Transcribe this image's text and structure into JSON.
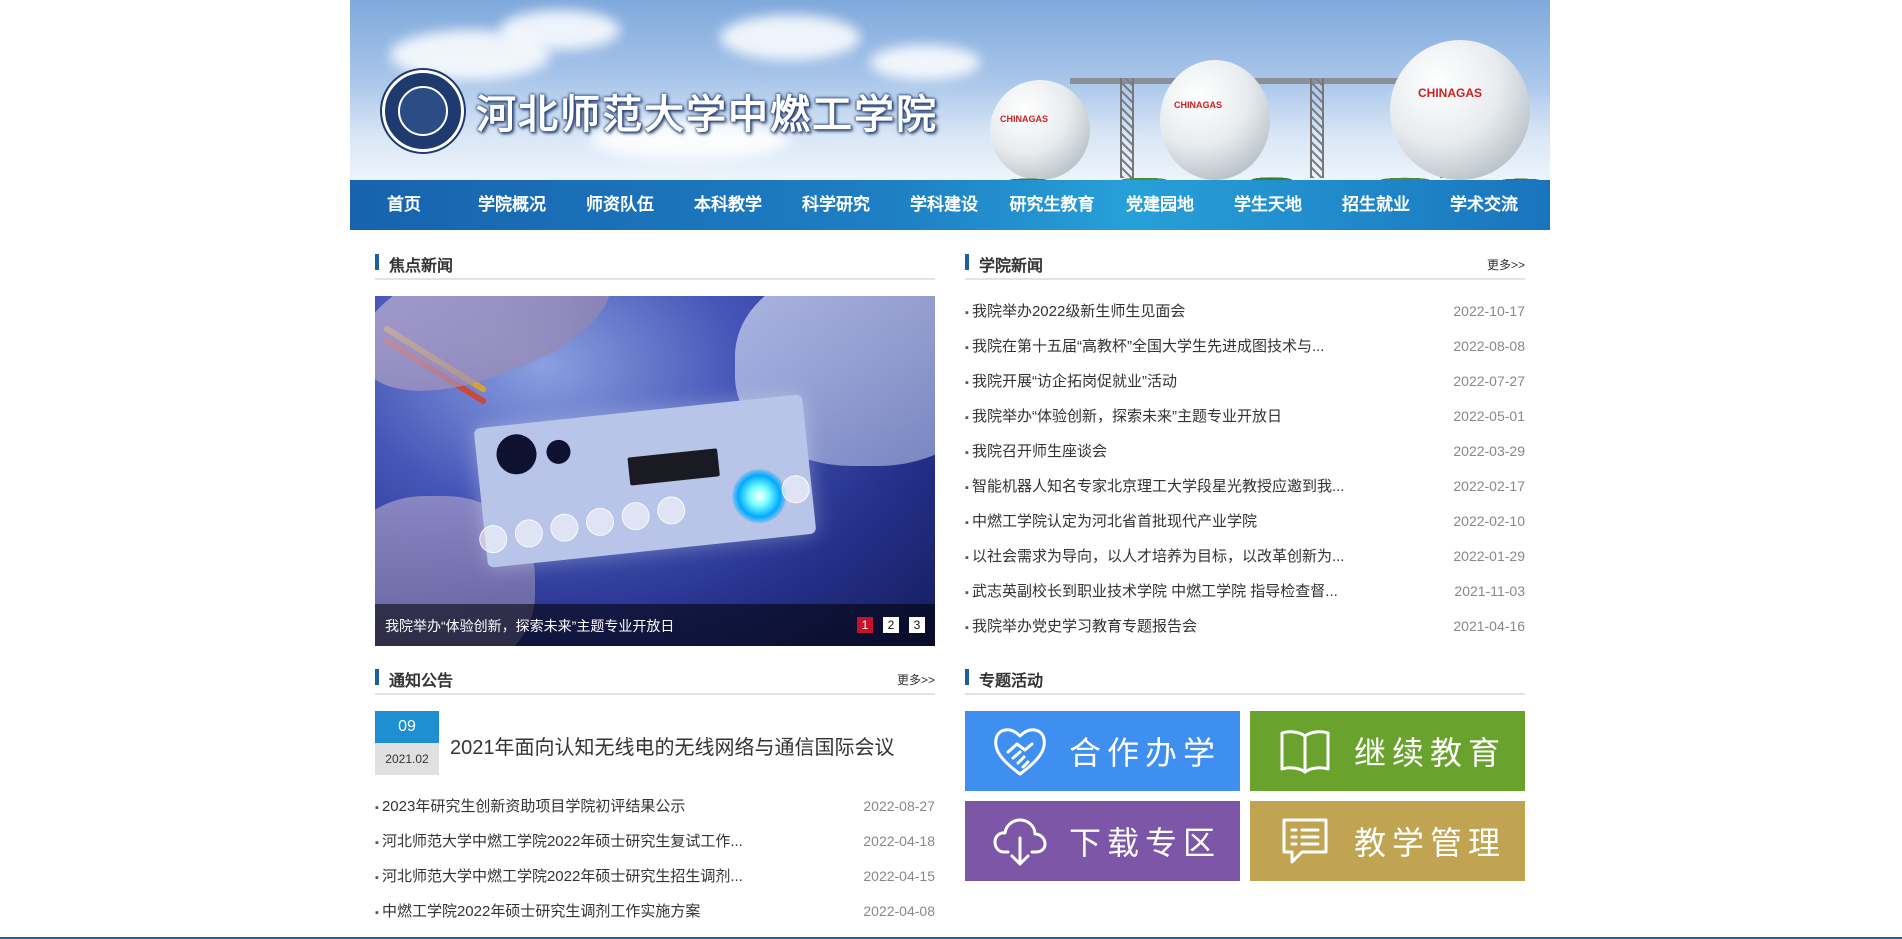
{
  "header": {
    "site_title": "河北师范大学中燃工学院",
    "tank_logo": "CHINAGAS"
  },
  "nav": [
    "首页",
    "学院概况",
    "师资队伍",
    "本科教学",
    "科学研究",
    "学科建设",
    "研究生教育",
    "党建园地",
    "学生天地",
    "招生就业",
    "学术交流"
  ],
  "focus": {
    "title": "焦点新闻",
    "caption": "我院举办“体验创新，探索未来”主题专业开放日",
    "pages": [
      "1",
      "2",
      "3"
    ],
    "active_page": "1"
  },
  "college_news": {
    "title": "学院新闻",
    "more": "更多>>",
    "items": [
      {
        "title": "我院举办2022级新生师生见面会",
        "date": "2022-10-17"
      },
      {
        "title": "我院在第十五届“高教杯”全国大学生先进成图技术与...",
        "date": "2022-08-08"
      },
      {
        "title": "我院开展“访企拓岗促就业”活动",
        "date": "2022-07-27"
      },
      {
        "title": "我院举办“体验创新，探索未来”主题专业开放日",
        "date": "2022-05-01"
      },
      {
        "title": "我院召开师生座谈会",
        "date": "2022-03-29"
      },
      {
        "title": "智能机器人知名专家北京理工大学段星光教授应邀到我...",
        "date": "2022-02-17"
      },
      {
        "title": "中燃工学院认定为河北省首批现代产业学院",
        "date": "2022-02-10"
      },
      {
        "title": "以社会需求为导向，以人才培养为目标，以改革创新为...",
        "date": "2022-01-29"
      },
      {
        "title": "武志英副校长到职业技术学院 中燃工学院 指导检查督...",
        "date": "2021-11-03"
      },
      {
        "title": "我院举办党史学习教育专题报告会",
        "date": "2021-04-16"
      }
    ]
  },
  "notices": {
    "title": "通知公告",
    "more": "更多>>",
    "featured": {
      "day": "09",
      "year_month": "2021.02",
      "title": "2021年面向认知无线电的无线网络与通信国际会议"
    },
    "items": [
      {
        "title": "2023年研究生创新资助项目学院初评结果公示",
        "date": "2022-08-27"
      },
      {
        "title": "河北师范大学中燃工学院2022年硕士研究生复试工作...",
        "date": "2022-04-18"
      },
      {
        "title": "河北师范大学中燃工学院2022年硕士研究生招生调剂...",
        "date": "2022-04-15"
      },
      {
        "title": "中燃工学院2022年硕士研究生调剂工作实施方案",
        "date": "2022-04-08"
      }
    ]
  },
  "topics": {
    "title": "专题活动",
    "tiles": [
      {
        "label": "合作办学",
        "icon": "handshake-heart-icon",
        "color": "#3f8ff0"
      },
      {
        "label": "继续教育",
        "icon": "open-book-icon",
        "color": "#6aa22e"
      },
      {
        "label": "下载专区",
        "icon": "cloud-download-icon",
        "color": "#7d56a8"
      },
      {
        "label": "教学管理",
        "icon": "document-list-icon",
        "color": "#c0a452"
      }
    ]
  },
  "colors": {
    "nav_start": "#1763ad",
    "nav_end": "#27a0d8",
    "accent_bar": "#1a5fa8",
    "active_dot": "#c4142d"
  }
}
